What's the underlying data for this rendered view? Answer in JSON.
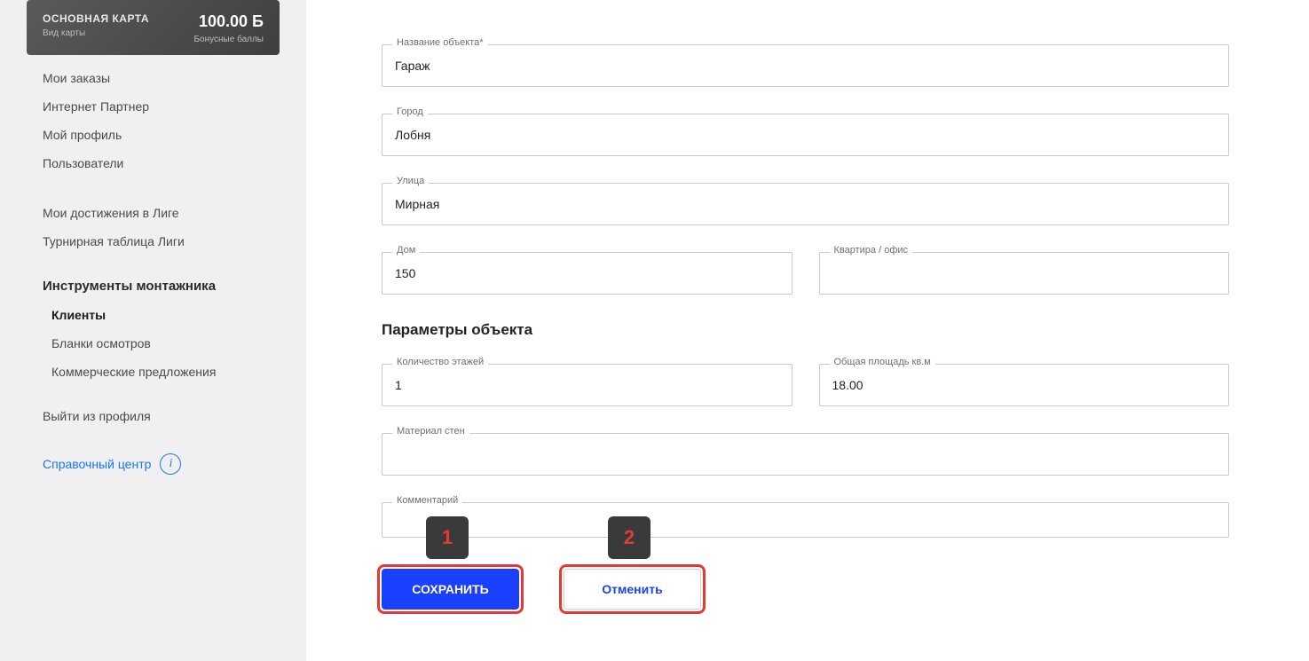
{
  "sidebar": {
    "card": {
      "title": "ОСНОВНАЯ КАРТА",
      "subtitle": "Вид карты",
      "points_value": "100.00 Б",
      "points_label": "Бонусные баллы"
    },
    "nav": {
      "my_orders": "Мои заказы",
      "internet_partner": "Интернет Партнер",
      "my_profile": "Мой профиль",
      "users": "Пользователи",
      "achievements": "Мои достижения в Лиге",
      "league_table": "Турнирная таблица Лиги",
      "tools_heading": "Инструменты монтажника",
      "clients": "Клиенты",
      "blanks": "Бланки осмотров",
      "commercial_offers": "Коммерческие предложения",
      "logout": "Выйти из профиля"
    },
    "help_label": "Справочный центр"
  },
  "form": {
    "fields": {
      "object_name_label": "Название объекта*",
      "object_name_value": "Гараж",
      "city_label": "Город",
      "city_value": "Лобня",
      "street_label": "Улица",
      "street_value": "Мирная",
      "house_label": "Дом",
      "house_value": "150",
      "apt_label": "Квартира / офис",
      "apt_value": "",
      "floors_label": "Количество этажей",
      "floors_value": "1",
      "area_label": "Общая площадь кв.м",
      "area_value": "18.00",
      "wall_label": "Материал стен",
      "wall_value": "",
      "comment_label": "Комментарий",
      "comment_value": ""
    },
    "section_title": "Параметры объекта",
    "buttons": {
      "save": "СОХРАНИТЬ",
      "cancel": "Отменить"
    },
    "callouts": {
      "one": "1",
      "two": "2"
    }
  }
}
